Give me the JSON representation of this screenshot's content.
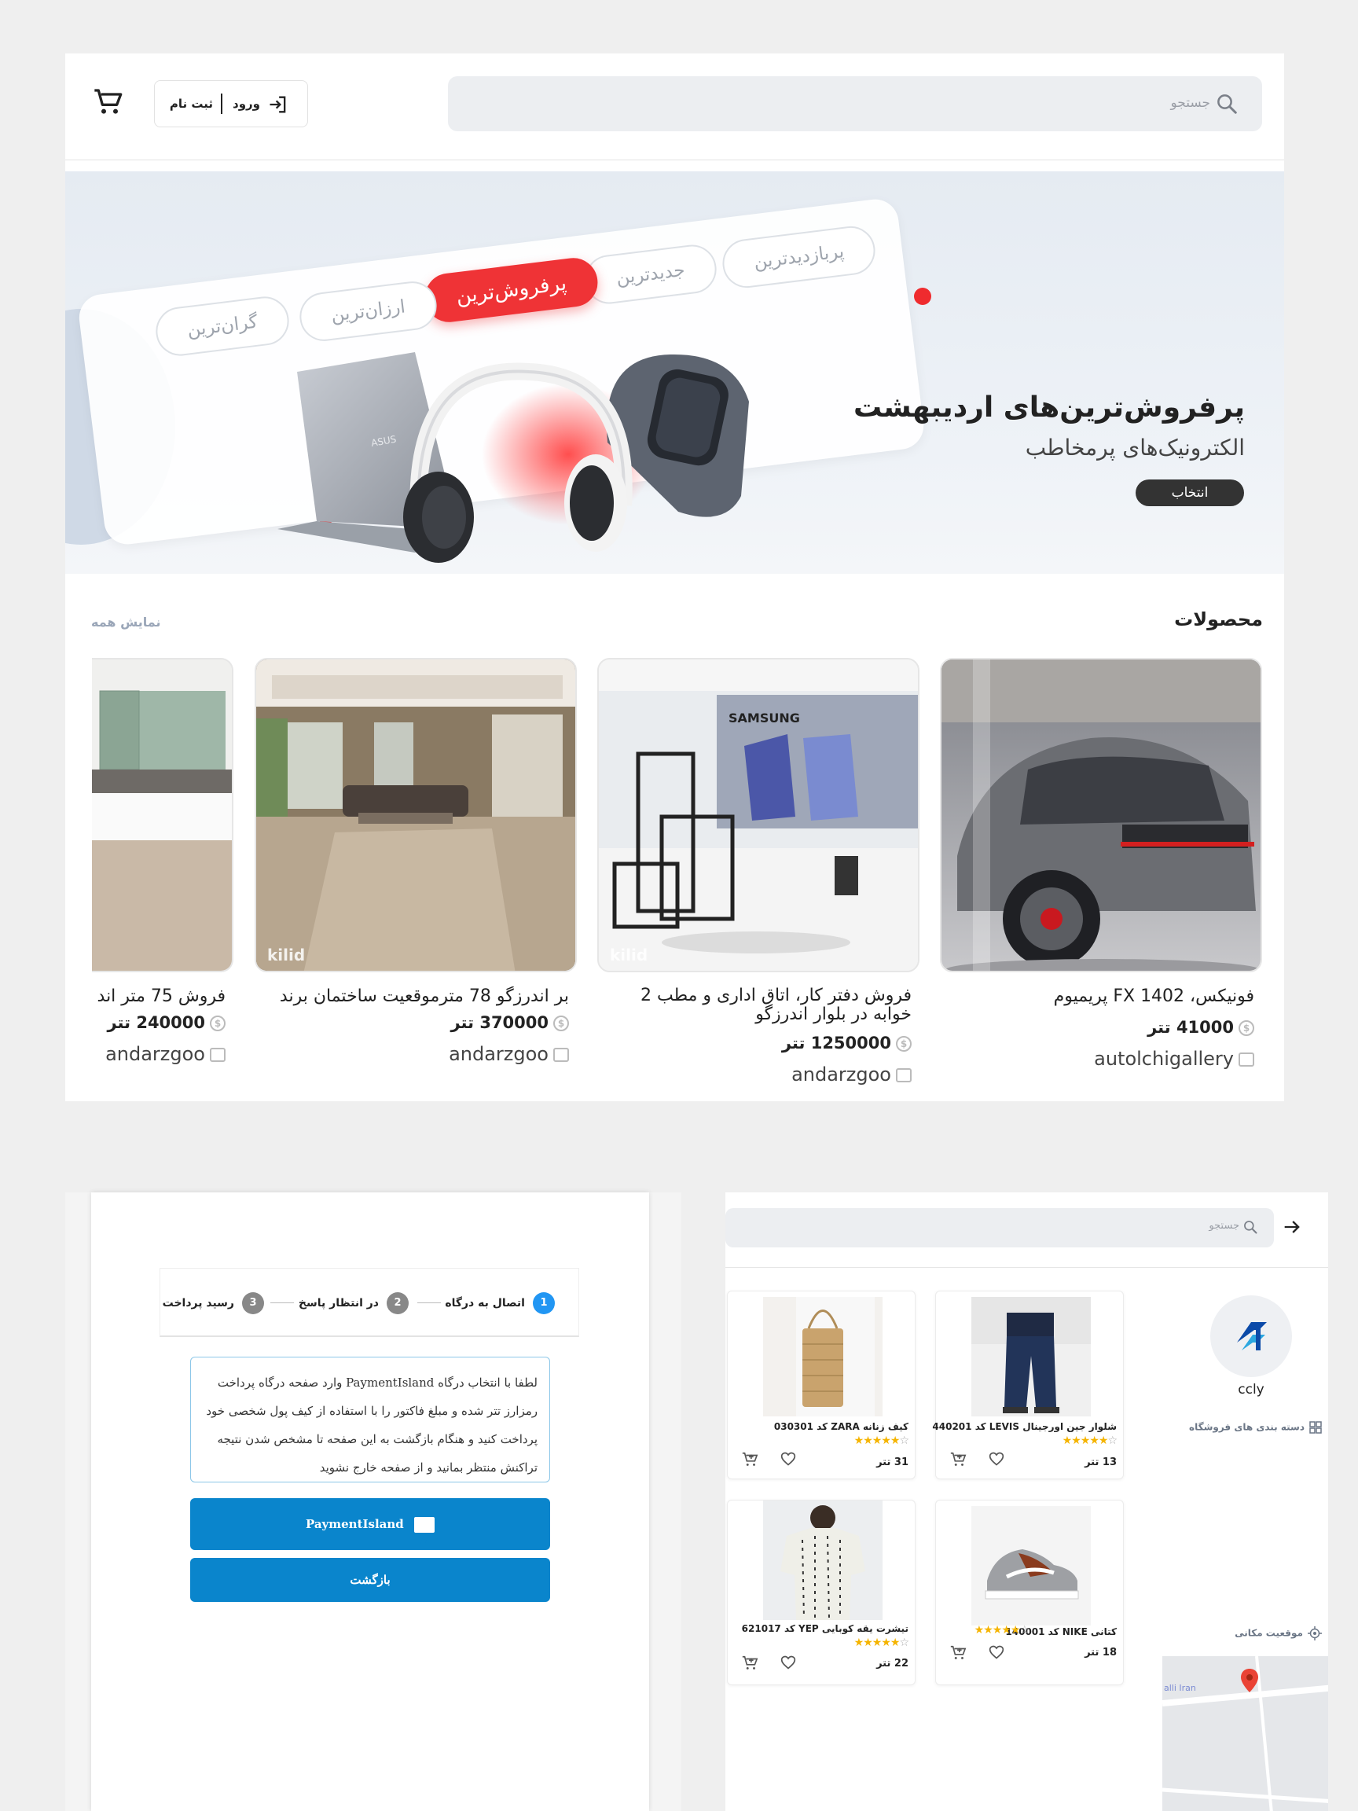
{
  "header": {
    "search_placeholder": "جستجو",
    "login_label": "ورود",
    "signup_label": "ثبت نام"
  },
  "banner": {
    "tabs": [
      "پربازدیدترین",
      "جدیدترین",
      "پرفروش‌ترین",
      "ارزان‌ترین",
      "گران‌ترین"
    ],
    "active_tab": "پرفروش‌ترین",
    "title": "پرفروش‌ترین‌های اردیبهشت",
    "subtitle": "الکترونیک‌های پرمخاطب",
    "button": "انتخاب",
    "accent_color": "#ef3336"
  },
  "products": {
    "title": "محصولات",
    "view_all": "نمایش همه",
    "currency_unit": "تتر",
    "items": [
      {
        "title": "فونیکس، FX 1402 پریمیوم",
        "price": "41000",
        "store": "autolchigallery"
      },
      {
        "title": "فروش دفتر کار، اتاق اداری و مطب 2 خوابه در بلوار اندرزگو",
        "price": "1250000",
        "store": "andarzgoo"
      },
      {
        "title": "بر اندرزگو 78 مترموقعیت ساختمان برند",
        "price": "370000",
        "store": "andarzgoo"
      },
      {
        "title": "فروش 75 متر اند",
        "price": "240000",
        "store": "andarzgoo"
      }
    ],
    "watermark": "kilid"
  },
  "payment": {
    "steps": [
      {
        "num": "1",
        "label": "اتصال به درگاه"
      },
      {
        "num": "2",
        "label": "در انتظار پاسخ"
      },
      {
        "num": "3",
        "label": "رسید پرداخت"
      }
    ],
    "notice": "لطفا با انتخاب درگاه PaymentIsland وارد صفحه درگاه پرداخت رمزارز تتر شده و مبلغ فاکتور را با استفاده از کیف پول شخصی خود پرداخت کنید و هنگام بازگشت به این صفحه تا مشخص شدن نتیجه تراکنش منتظر بمانید و از صفحه خارج نشوید",
    "gateway_button": "PaymentIsland",
    "back_button": "بازگشت",
    "button_color": "#0a85cc"
  },
  "store": {
    "search_placeholder": "جستجو",
    "name": "ccly",
    "categories_label": "دسته بندی های فروشگاه",
    "location_label": "موقعیت مکانی",
    "map_label": "alli Iran",
    "items": [
      {
        "title": "شلوار جین اورجینال LEVIS کد 440201",
        "price": "13 تتر",
        "stars": 5
      },
      {
        "title": "کیف زنانه ZARA کد 030301",
        "price": "31 تتر",
        "stars": 5
      },
      {
        "title": "کتانی NIKE کد 140001",
        "price": "18 تتر",
        "stars": 5
      },
      {
        "title": "تیشرت یقه کوبایی YEP کد 621017",
        "price": "22 تتر",
        "stars": 5
      }
    ]
  }
}
